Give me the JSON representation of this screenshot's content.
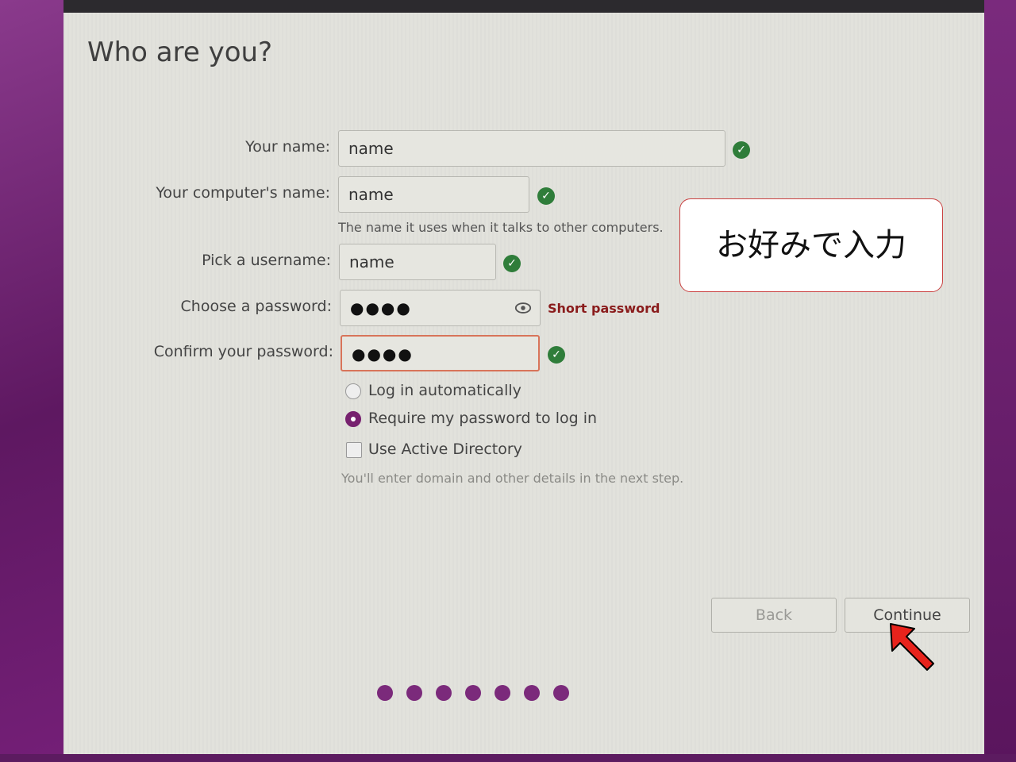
{
  "page": {
    "title": "Who are you?"
  },
  "form": {
    "your_name": {
      "label": "Your name:",
      "value": "name",
      "valid": true
    },
    "computer_name": {
      "label": "Your computer's name:",
      "value": "name",
      "valid": true,
      "hint": "The name it uses when it talks to other computers."
    },
    "username": {
      "label": "Pick a username:",
      "value": "name",
      "valid": true
    },
    "password": {
      "label": "Choose a password:",
      "value": "●●●●",
      "strength": "Short password"
    },
    "confirm_password": {
      "label": "Confirm your password:",
      "value": "●●●●",
      "valid": true
    },
    "login_options": {
      "auto_login": {
        "label": "Log in automatically",
        "selected": false
      },
      "require_password": {
        "label": "Require my password to log in",
        "selected": true
      }
    },
    "active_directory": {
      "label": "Use Active Directory",
      "checked": false,
      "hint": "You'll enter domain and other details in the next step."
    }
  },
  "buttons": {
    "back": "Back",
    "continue": "Continue"
  },
  "progress": {
    "total_steps": 7
  },
  "annotation": {
    "callout_text": "お好みで入力"
  },
  "colors": {
    "accent": "#77216f",
    "valid": "#2f7d3a",
    "warning": "#8a1c1c",
    "callout_border": "#c94040",
    "pointer_arrow": "#e8231c"
  }
}
